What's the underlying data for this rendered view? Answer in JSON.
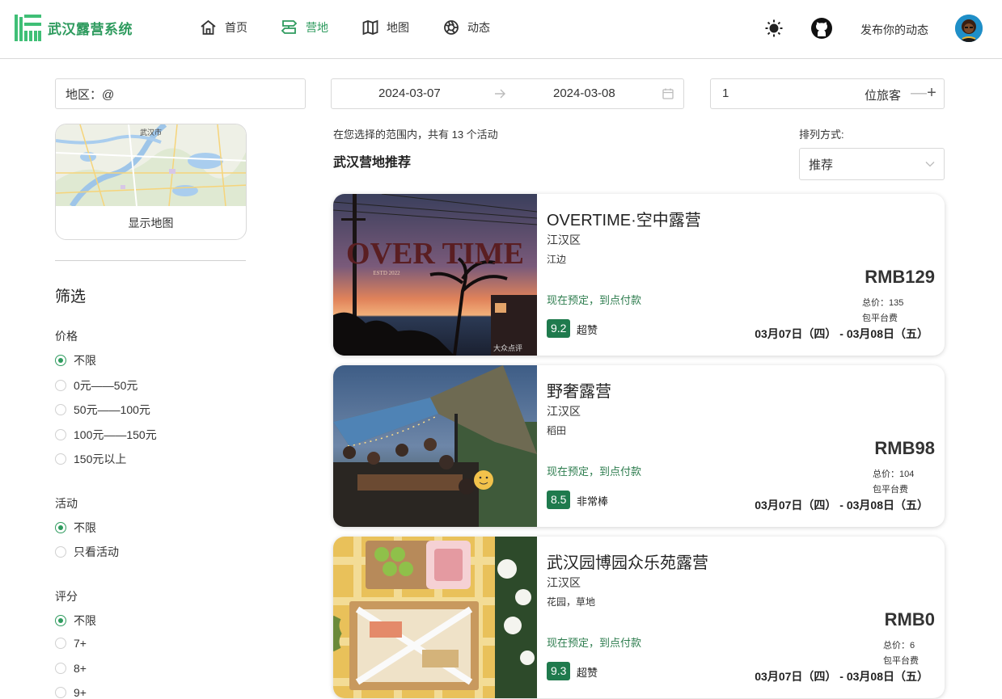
{
  "app": {
    "title": "武汉露营系统"
  },
  "nav": {
    "home": "首页",
    "camps": "营地",
    "map": "地图",
    "feed": "动态"
  },
  "header": {
    "publish": "发布你的动态"
  },
  "search": {
    "region_value": "地区：@",
    "start_date": "2024-03-07",
    "end_date": "2024-03-08",
    "guests": "1",
    "guests_label": "位旅客",
    "minus": "—",
    "plus": "+"
  },
  "map_card": {
    "label": "显示地图",
    "map_text": "武汉市"
  },
  "filters": {
    "title": "筛选",
    "price": {
      "label": "价格",
      "options": [
        "不限",
        "0元——50元",
        "50元——100元",
        "100元——150元",
        "150元以上"
      ],
      "selected": "不限"
    },
    "activity": {
      "label": "活动",
      "options": [
        "不限",
        "只看活动"
      ],
      "selected": "不限"
    },
    "rating": {
      "label": "评分",
      "options": [
        "不限",
        "7+",
        "8+",
        "9+"
      ],
      "selected": "不限"
    }
  },
  "results": {
    "count_text": "在您选择的范围内，共有 13 个活动",
    "section_title": "武汉营地推荐",
    "sort_label": "排列方式:",
    "sort_value": "推荐"
  },
  "camps": [
    {
      "name": "OVERTIME·空中露营",
      "district": "江汉区",
      "tag": "江边",
      "booking": "现在预定，到点付款",
      "score": "9.2",
      "score_text": "超赞",
      "price": "RMB129",
      "total": "总价：135",
      "fee": "包平台费",
      "dates": "03月07日（四） - 03月08日（五）",
      "photo_text": "OVER TIME",
      "photo_sub": "ESTD 2022",
      "photo_watermark": "大众点评"
    },
    {
      "name": "野奢露营",
      "district": "江汉区",
      "tag": "稻田",
      "booking": "现在预定，到点付款",
      "score": "8.5",
      "score_text": "非常棒",
      "price": "RMB98",
      "total": "总价：104",
      "fee": "包平台费",
      "dates": "03月07日（四） - 03月08日（五）"
    },
    {
      "name": "武汉园博园众乐苑露营",
      "district": "江汉区",
      "tag": "花园，草地",
      "booking": "现在预定，到点付款",
      "score": "9.3",
      "score_text": "超赞",
      "price": "RMB0",
      "total": "总价：6",
      "fee": "包平台费",
      "dates": "03月07日（四） - 03月08日（五）"
    }
  ],
  "colors": {
    "accent": "#2e9b5e",
    "score_badge": "#1f7a4d",
    "booking_text": "#2e7d4f"
  }
}
